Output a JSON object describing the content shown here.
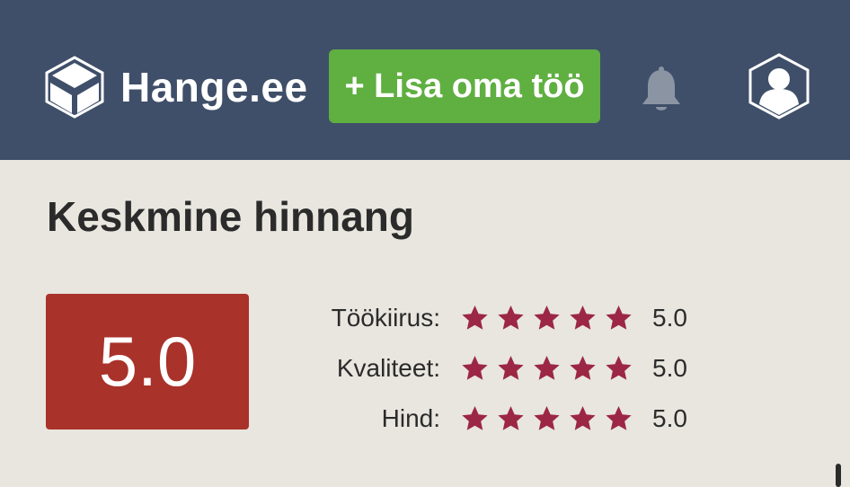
{
  "header": {
    "brand": "Hange.ee",
    "add_button_label": "+ Lisa oma töö",
    "bell_icon": "bell-icon",
    "avatar_icon": "user-avatar-icon"
  },
  "colors": {
    "header_bg": "#3f4f69",
    "button_green": "#5faf41",
    "score_red": "#a9322b",
    "star_color": "#9c2744",
    "page_bg": "#e8e6df"
  },
  "main": {
    "title": "Keskmine hinnang",
    "average_score": "5.0",
    "ratings": [
      {
        "label": "Töökiirus:",
        "value": "5.0",
        "stars": 5
      },
      {
        "label": "Kvaliteet:",
        "value": "5.0",
        "stars": 5
      },
      {
        "label": "Hind:",
        "value": "5.0",
        "stars": 5
      }
    ]
  }
}
